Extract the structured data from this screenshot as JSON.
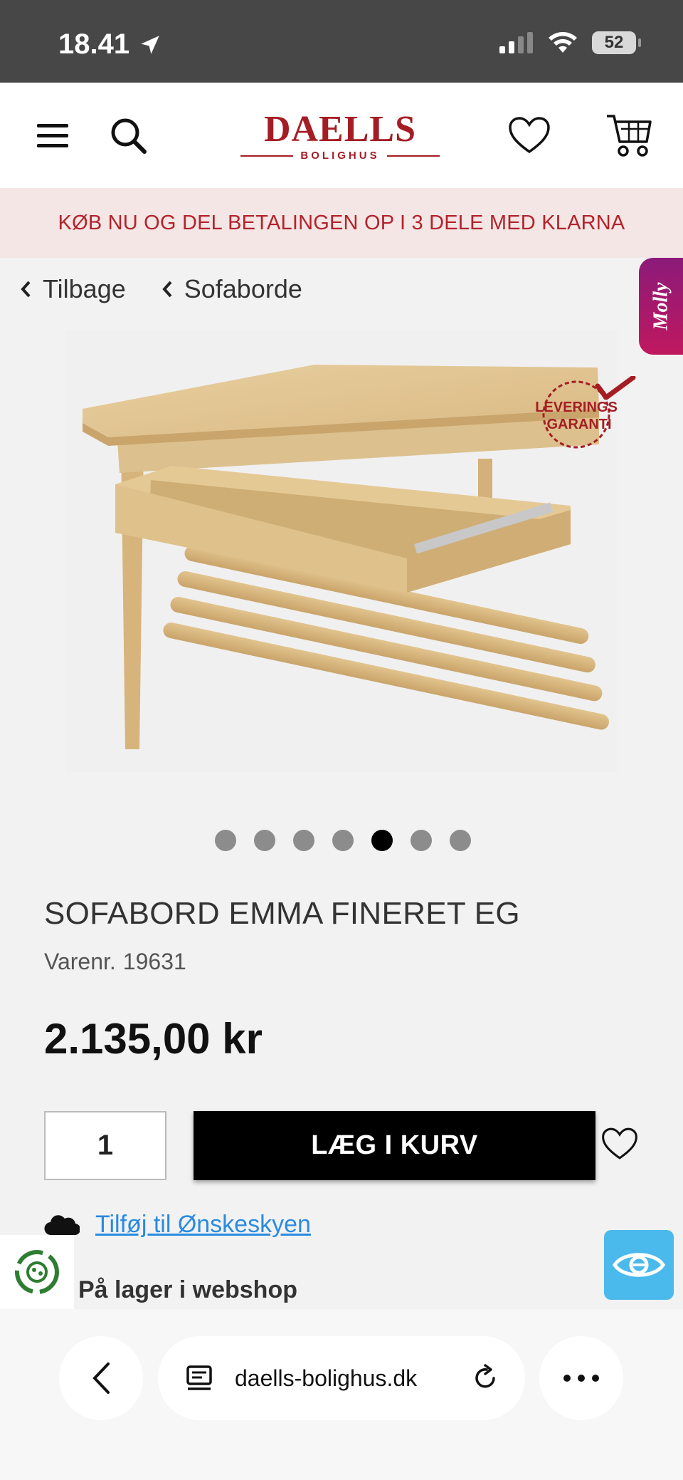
{
  "status_bar": {
    "time": "18.41",
    "battery": "52"
  },
  "header": {
    "logo_main": "DAELLS",
    "logo_sub": "BOLIGHUS"
  },
  "promo": {
    "text": "KØB NU OG DEL BETALINGEN OP I 3 DELE MED KLARNA"
  },
  "breadcrumb": {
    "back_label": "Tilbage",
    "category_label": "Sofaborde"
  },
  "molly": {
    "label": "Molly"
  },
  "badge": {
    "line1": "LEVERINGS",
    "line2": "GARANTI"
  },
  "carousel": {
    "count": 7,
    "active_index": 4
  },
  "product": {
    "title": "SOFABORD EMMA FINERET EG",
    "sku_label": "Varenr.",
    "sku": "19631",
    "price": "2.135,00 kr",
    "quantity": "1",
    "add_to_cart": "LÆG I KURV",
    "wishlist_link": "Tilføj til Ønskeskyen",
    "stock": "På lager i webshop"
  },
  "browser": {
    "url": "daells-bolighus.dk"
  },
  "colors": {
    "brand": "#a51d24",
    "promo_bg": "#f5e6e6",
    "link": "#2a8be0",
    "accessibility": "#4ab9ec"
  }
}
